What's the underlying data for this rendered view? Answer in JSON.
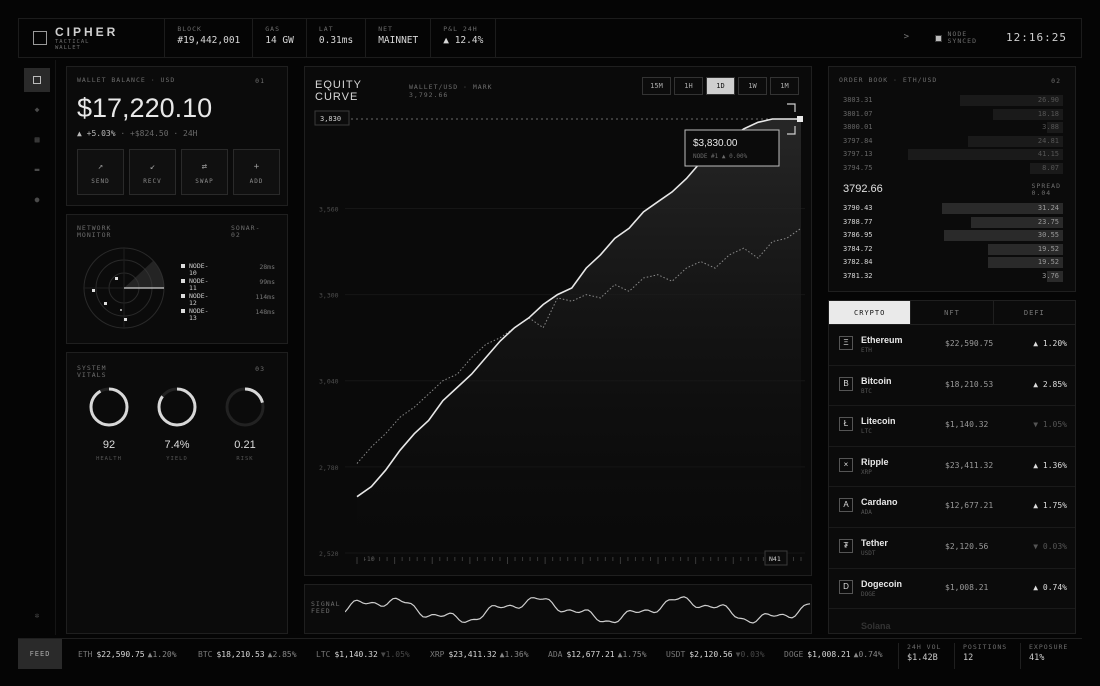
{
  "brand": {
    "name": "CIPHER",
    "subtitle": "TACTICAL WALLET"
  },
  "top_stats": [
    {
      "label": "BLOCK",
      "value": "#19,442,001"
    },
    {
      "label": "GAS",
      "value": "14 GW"
    },
    {
      "label": "LAT",
      "value": "0.31ms"
    },
    {
      "label": "NET",
      "value": "MAINNET"
    },
    {
      "label": "P&L 24H",
      "value": "▲ 12.4%"
    }
  ],
  "node_status": {
    "line1": "NODE",
    "line2": "SYNCED"
  },
  "clock": "12:16:25",
  "wallet": {
    "label": "WALLET BALANCE · USD",
    "index": "01",
    "balance": "$17,220.10",
    "change_pct": "▲ +5.03%",
    "change_abs": "+$824.50",
    "period": "24H",
    "actions": [
      {
        "icon": "↗",
        "label": "SEND",
        "name": "send"
      },
      {
        "icon": "↙",
        "label": "RECV",
        "name": "recv"
      },
      {
        "icon": "⇄",
        "label": "SWAP",
        "name": "swap"
      },
      {
        "icon": "+",
        "label": "ADD",
        "name": "add"
      }
    ]
  },
  "network": {
    "label": "NETWORK MONITOR",
    "tag": "SONAR-02",
    "nodes": [
      {
        "name": "NODE-10",
        "latency": "28ms"
      },
      {
        "name": "NODE-11",
        "latency": "99ms"
      },
      {
        "name": "NODE-12",
        "latency": "114ms"
      },
      {
        "name": "NODE-13",
        "latency": "148ms"
      }
    ]
  },
  "vitals": {
    "label": "SYSTEM VITALS",
    "index": "03",
    "gauges": [
      {
        "value": "92",
        "label": "HEALTH",
        "fraction": 0.92
      },
      {
        "value": "7.4%",
        "label": "YIELD",
        "fraction": 0.85
      },
      {
        "value": "0.21",
        "label": "RISK",
        "fraction": 0.21
      }
    ]
  },
  "equity": {
    "title": "EQUITY CURVE",
    "subtitle": "WALLET/USD · MARK",
    "mark": "3,792.66",
    "timeframes": [
      "15M",
      "1H",
      "1D",
      "1W",
      "1M"
    ],
    "active_timeframe": "1D",
    "callout_value": "$3,830.00",
    "callout_note": "NODE #1  ▲ 0.00%",
    "peak_tag": "3,830",
    "y_labels": [
      "3,560",
      "3,300",
      "3,040",
      "2,780",
      "2,520"
    ],
    "x_start": "-10",
    "x_end": "N41",
    "feed_label": "SIGNAL FEED"
  },
  "chart_data": {
    "type": "line",
    "ylim": [
      2520,
      3830
    ],
    "series": [
      {
        "values": [
          2690,
          2720,
          2770,
          2830,
          2880,
          2920,
          2980,
          3020,
          3060,
          3110,
          3160,
          3200,
          3230,
          3270,
          3300,
          3320,
          3380,
          3420,
          3470,
          3500,
          3550,
          3580,
          3610,
          3650,
          3700,
          3730,
          3770,
          3800,
          3820,
          3830,
          3830,
          3830
        ]
      },
      {
        "values": [
          2790,
          2840,
          2880,
          2930,
          2960,
          3000,
          3040,
          3060,
          3110,
          3150,
          3170,
          3200,
          3230,
          3200,
          3290,
          3280,
          3300,
          3290,
          3330,
          3310,
          3350,
          3360,
          3340,
          3380,
          3400,
          3380,
          3420,
          3440,
          3410,
          3460,
          3470,
          3500
        ]
      }
    ]
  },
  "orderbook": {
    "title": "ORDER BOOK · ETH/USD",
    "index": "02",
    "asks": [
      {
        "price": "3803.31",
        "size": "26.90",
        "depth": 0.63
      },
      {
        "price": "3801.07",
        "size": "18.18",
        "depth": 0.43
      },
      {
        "price": "3800.01",
        "size": "3.88",
        "depth": 0.1
      },
      {
        "price": "3797.84",
        "size": "24.81",
        "depth": 0.58
      },
      {
        "price": "3797.13",
        "size": "41.15",
        "depth": 0.95
      },
      {
        "price": "3794.75",
        "size": "8.07",
        "depth": 0.2
      }
    ],
    "mid": "3792.66",
    "spread_label": "SPREAD",
    "spread": "0.04",
    "bids": [
      {
        "price": "3790.43",
        "size": "31.24",
        "depth": 0.74
      },
      {
        "price": "3788.77",
        "size": "23.75",
        "depth": 0.56
      },
      {
        "price": "3786.95",
        "size": "30.55",
        "depth": 0.73
      },
      {
        "price": "3784.72",
        "size": "19.52",
        "depth": 0.46
      },
      {
        "price": "3782.84",
        "size": "19.52",
        "depth": 0.46
      },
      {
        "price": "3781.32",
        "size": "3.76",
        "depth": 0.1
      }
    ]
  },
  "market": {
    "tabs": [
      "CRYPTO",
      "NFT",
      "DEFI"
    ],
    "coins": [
      {
        "icon": "Ξ",
        "name": "Ethereum",
        "symbol": "ETH",
        "price": "$22,590.75",
        "change": "▲ 1.20%",
        "up": true
      },
      {
        "icon": "B",
        "name": "Bitcoin",
        "symbol": "BTC",
        "price": "$18,210.53",
        "change": "▲ 2.85%",
        "up": true
      },
      {
        "icon": "Ł",
        "name": "Litecoin",
        "symbol": "LTC",
        "price": "$1,140.32",
        "change": "▼ 1.05%",
        "up": false
      },
      {
        "icon": "×",
        "name": "Ripple",
        "symbol": "XRP",
        "price": "$23,411.32",
        "change": "▲ 1.36%",
        "up": true
      },
      {
        "icon": "A",
        "name": "Cardano",
        "symbol": "ADA",
        "price": "$12,677.21",
        "change": "▲ 1.75%",
        "up": true
      },
      {
        "icon": "₮",
        "name": "Tether",
        "symbol": "USDT",
        "price": "$2,120.56",
        "change": "▼ 0.03%",
        "up": false
      },
      {
        "icon": "D",
        "name": "Dogecoin",
        "symbol": "DOGE",
        "price": "$1,008.21",
        "change": "▲ 0.74%",
        "up": true
      }
    ],
    "partial": "Solana"
  },
  "ticker": {
    "feed_label": "FEED",
    "items": [
      {
        "symbol": "ETH",
        "price": "$22,590.75",
        "change": "▲1.20%",
        "up": true
      },
      {
        "symbol": "BTC",
        "price": "$18,210.53",
        "change": "▲2.85%",
        "up": true
      },
      {
        "symbol": "LTC",
        "price": "$1,140.32",
        "change": "▼1.05%",
        "up": false
      },
      {
        "symbol": "XRP",
        "price": "$23,411.32",
        "change": "▲1.36%",
        "up": true
      },
      {
        "symbol": "ADA",
        "price": "$12,677.21",
        "change": "▲1.75%",
        "up": true
      },
      {
        "symbol": "USDT",
        "price": "$2,120.56",
        "change": "▼0.03%",
        "up": false
      },
      {
        "symbol": "DOGE",
        "price": "$1,008.21",
        "change": "▲0.74%",
        "up": true
      }
    ],
    "stats": [
      {
        "label": "24H VOL",
        "value": "$1.42B"
      },
      {
        "label": "POSITIONS",
        "value": "12"
      },
      {
        "label": "EXPOSURE",
        "value": "41%"
      }
    ]
  }
}
